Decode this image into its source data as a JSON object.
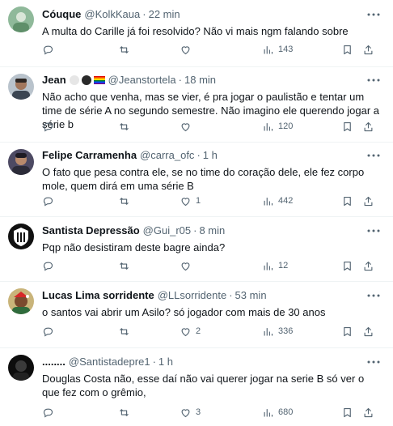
{
  "tweets": [
    {
      "name": "Cóuque",
      "handle": "@KolkKaua",
      "dot": "·",
      "time": "22 min",
      "text": "A multa do Carille já foi resolvido? Não vi mais ngm falando sobre",
      "replies": "",
      "retweets": "",
      "likes": "",
      "views": "143"
    },
    {
      "name": "Jean",
      "handle": "@Jeanstortela",
      "dot": "·",
      "time": "18 min",
      "text": "Não acho que venha, mas se vier, é pra jogar o paulistão e tentar um time de série A no segundo semestre. Não imagino ele querendo jogar a série b",
      "replies": "",
      "retweets": "",
      "likes": "",
      "views": "120"
    },
    {
      "name": "Felipe Carramenha",
      "handle": "@carra_ofc",
      "dot": "·",
      "time": "1 h",
      "text": "O fato que pesa contra ele, se no time do coração dele, ele fez corpo mole, quem dirá em uma série B",
      "replies": "",
      "retweets": "",
      "likes": "1",
      "views": "442"
    },
    {
      "name": "Santista Depressão",
      "handle": "@Gui_r05",
      "dot": "·",
      "time": "8 min",
      "text": "Pqp não desistiram deste bagre ainda?",
      "replies": "",
      "retweets": "",
      "likes": "",
      "views": "12"
    },
    {
      "name": "Lucas Lima sorridente",
      "handle": "@LLsorridente",
      "dot": "·",
      "time": "53 min",
      "text": "o santos vai abrir um Asilo? só jogador com mais de 30 anos",
      "replies": "",
      "retweets": "",
      "likes": "2",
      "views": "336"
    },
    {
      "name": "........",
      "handle": "@Santistadepre1",
      "dot": "·",
      "time": "1 h",
      "text": "Douglas Costa não, esse daí não vai querer jogar na serie B só ver o que fez com o grêmio,",
      "replies": "",
      "retweets": "",
      "likes": "3",
      "views": "680"
    }
  ],
  "icons": {
    "more": "more-icon",
    "reply": "reply-icon",
    "retweet": "retweet-icon",
    "like": "heart-icon",
    "views": "views-icon",
    "bookmark": "bookmark-icon",
    "share": "share-icon"
  },
  "colors": {
    "text": "#0f1419",
    "secondary": "#536471",
    "divider": "#eff3f4"
  }
}
